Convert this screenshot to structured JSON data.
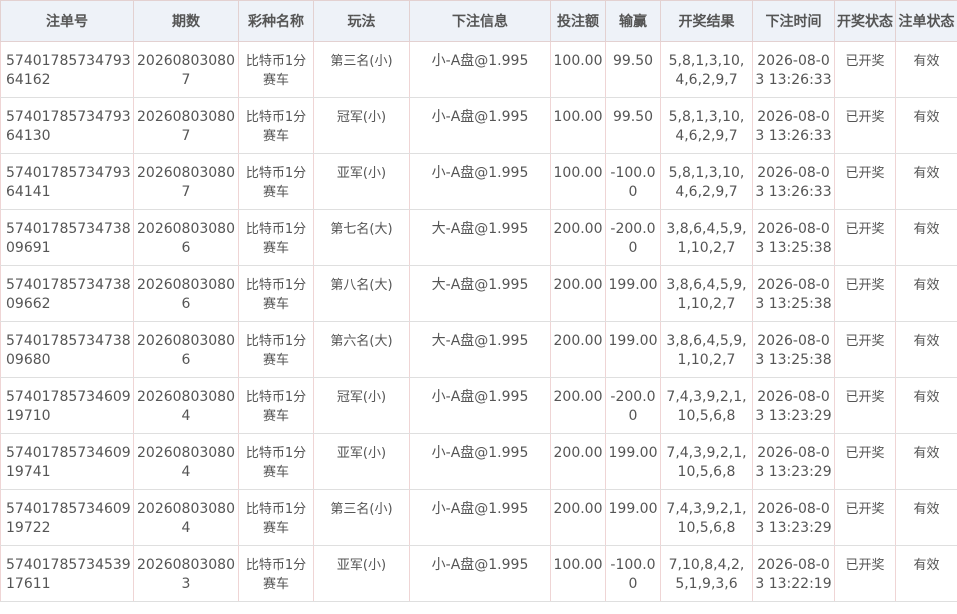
{
  "headers": {
    "order_no": "注单号",
    "issue": "期数",
    "lottery": "彩种名称",
    "play": "玩法",
    "bet_info": "下注信息",
    "amount": "投注额",
    "win_loss": "输赢",
    "result": "开奖结果",
    "bet_time": "下注时间",
    "draw_status": "开奖状态",
    "order_status": "注单状态"
  },
  "rows": [
    {
      "order_no": "5740178573479364162",
      "issue": "202608030807",
      "lottery": "比特币1分赛车",
      "play": "第三名(小)",
      "bet_info": "小-A盘@1.995",
      "amount": "100.00",
      "win_loss": "99.50",
      "result": "5,8,1,3,10,4,6,2,9,7",
      "bet_time": "2026-08-03 13:26:33",
      "draw_status": "已开奖",
      "order_status": "有效"
    },
    {
      "order_no": "5740178573479364130",
      "issue": "202608030807",
      "lottery": "比特币1分赛车",
      "play": "冠军(小)",
      "bet_info": "小-A盘@1.995",
      "amount": "100.00",
      "win_loss": "99.50",
      "result": "5,8,1,3,10,4,6,2,9,7",
      "bet_time": "2026-08-03 13:26:33",
      "draw_status": "已开奖",
      "order_status": "有效"
    },
    {
      "order_no": "5740178573479364141",
      "issue": "202608030807",
      "lottery": "比特币1分赛车",
      "play": "亚军(小)",
      "bet_info": "小-A盘@1.995",
      "amount": "100.00",
      "win_loss": "-100.00",
      "result": "5,8,1,3,10,4,6,2,9,7",
      "bet_time": "2026-08-03 13:26:33",
      "draw_status": "已开奖",
      "order_status": "有效"
    },
    {
      "order_no": "5740178573473809691",
      "issue": "202608030806",
      "lottery": "比特币1分赛车",
      "play": "第七名(大)",
      "bet_info": "大-A盘@1.995",
      "amount": "200.00",
      "win_loss": "-200.00",
      "result": "3,8,6,4,5,9,1,10,2,7",
      "bet_time": "2026-08-03 13:25:38",
      "draw_status": "已开奖",
      "order_status": "有效"
    },
    {
      "order_no": "5740178573473809662",
      "issue": "202608030806",
      "lottery": "比特币1分赛车",
      "play": "第八名(大)",
      "bet_info": "大-A盘@1.995",
      "amount": "200.00",
      "win_loss": "199.00",
      "result": "3,8,6,4,5,9,1,10,2,7",
      "bet_time": "2026-08-03 13:25:38",
      "draw_status": "已开奖",
      "order_status": "有效"
    },
    {
      "order_no": "5740178573473809680",
      "issue": "202608030806",
      "lottery": "比特币1分赛车",
      "play": "第六名(大)",
      "bet_info": "大-A盘@1.995",
      "amount": "200.00",
      "win_loss": "199.00",
      "result": "3,8,6,4,5,9,1,10,2,7",
      "bet_time": "2026-08-03 13:25:38",
      "draw_status": "已开奖",
      "order_status": "有效"
    },
    {
      "order_no": "5740178573460919710",
      "issue": "202608030804",
      "lottery": "比特币1分赛车",
      "play": "冠军(小)",
      "bet_info": "小-A盘@1.995",
      "amount": "200.00",
      "win_loss": "-200.00",
      "result": "7,4,3,9,2,1,10,5,6,8",
      "bet_time": "2026-08-03 13:23:29",
      "draw_status": "已开奖",
      "order_status": "有效"
    },
    {
      "order_no": "5740178573460919741",
      "issue": "202608030804",
      "lottery": "比特币1分赛车",
      "play": "亚军(小)",
      "bet_info": "小-A盘@1.995",
      "amount": "200.00",
      "win_loss": "199.00",
      "result": "7,4,3,9,2,1,10,5,6,8",
      "bet_time": "2026-08-03 13:23:29",
      "draw_status": "已开奖",
      "order_status": "有效"
    },
    {
      "order_no": "5740178573460919722",
      "issue": "202608030804",
      "lottery": "比特币1分赛车",
      "play": "第三名(小)",
      "bet_info": "小-A盘@1.995",
      "amount": "200.00",
      "win_loss": "199.00",
      "result": "7,4,3,9,2,1,10,5,6,8",
      "bet_time": "2026-08-03 13:23:29",
      "draw_status": "已开奖",
      "order_status": "有效"
    },
    {
      "order_no": "5740178573453917611",
      "issue": "202608030803",
      "lottery": "比特币1分赛车",
      "play": "亚军(小)",
      "bet_info": "小-A盘@1.995",
      "amount": "100.00",
      "win_loss": "-100.00",
      "result": "7,10,8,4,2,5,1,9,3,6",
      "bet_time": "2026-08-03 13:22:19",
      "draw_status": "已开奖",
      "order_status": "有效"
    }
  ]
}
